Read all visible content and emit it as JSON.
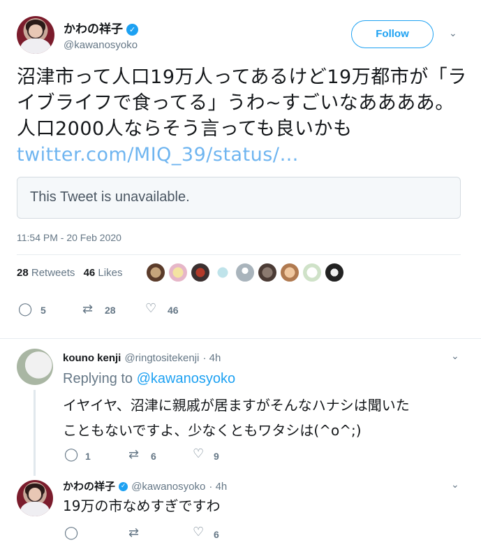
{
  "tweet": {
    "author_name": "かわの祥子",
    "author_handle": "@kawanosyoko",
    "follow_label": "Follow",
    "text": "沼津市って人口19万人ってあるけど19万都市が「ライブライフで食ってる」うわ~すごいなああああ。人口2000人ならそう言っても良いかも",
    "link": "twitter.com/MIQ_39/status/…",
    "quote_unavailable": "This Tweet is unavailable.",
    "timestamp": "11:54 PM - 20 Feb 2020",
    "retweets_count": "28",
    "retweets_label": "Retweets",
    "likes_count": "46",
    "likes_label": "Likes",
    "actions": {
      "replies": "5",
      "retweets": "28",
      "likes": "46"
    }
  },
  "replies": [
    {
      "name": "kouno kenji",
      "handle": "@ringtositekenji",
      "time": "· 4h",
      "replying_prefix": "Replying to",
      "replying_to": "@kawanosyoko",
      "text_line1": "イヤイヤ、沼津に親戚が居ますがそんなハナシは聞いた",
      "text_line2": "こともないですよ、少なくともワタシは(^o^;)",
      "replies": "1",
      "retweets": "6",
      "likes": "9"
    },
    {
      "name": "かわの祥子",
      "handle": "@kawanosyoko",
      "time": "· 4h",
      "text": "19万の市なめすぎですわ",
      "replies": "",
      "retweets": "",
      "likes": "6"
    }
  ],
  "colors": {
    "accent": "#1da1f2",
    "link": "#6fb5f0",
    "muted": "#657786"
  },
  "icons": [
    "verified-badge-icon",
    "chevron-down-icon",
    "reply-icon",
    "retweet-icon",
    "like-icon"
  ]
}
